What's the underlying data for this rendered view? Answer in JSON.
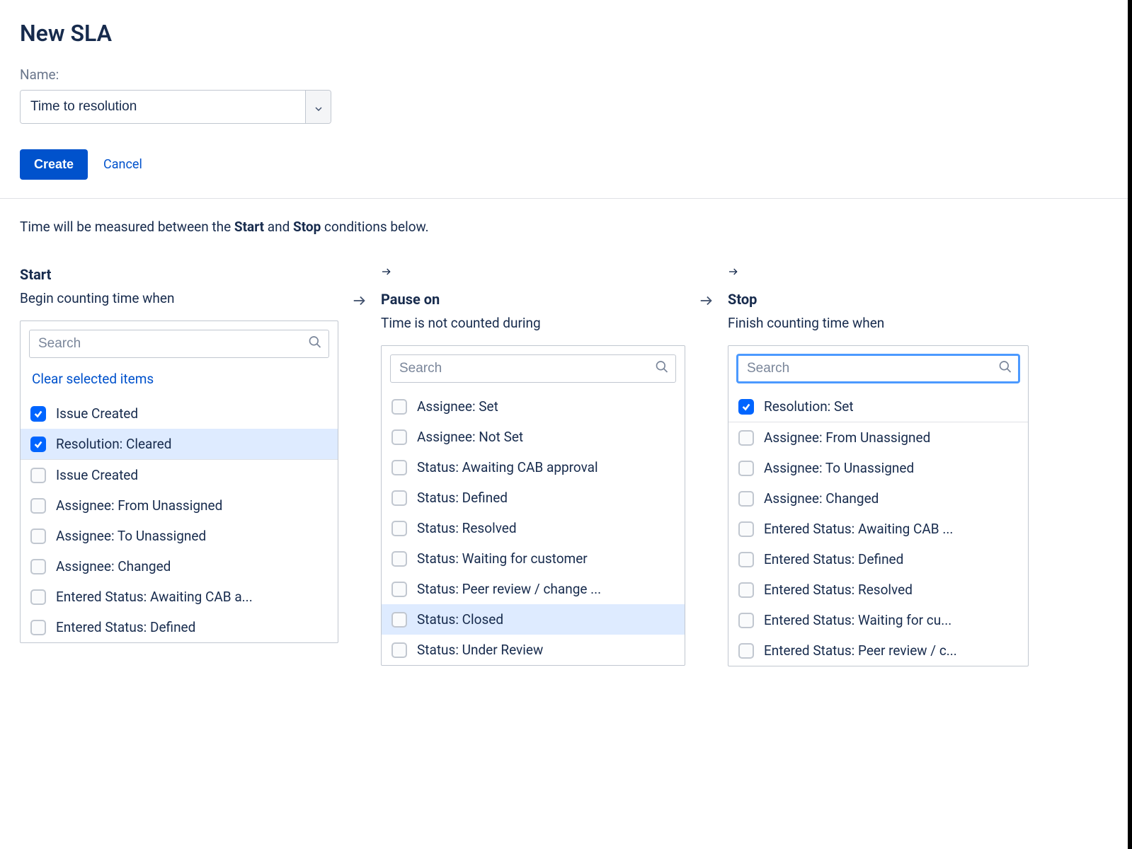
{
  "title": "New SLA",
  "name_label": "Name:",
  "name_value": "Time to resolution",
  "create_label": "Create",
  "cancel_label": "Cancel",
  "measure_prefix": "Time will be measured between the ",
  "measure_mid": " and ",
  "measure_suffix": " conditions below.",
  "start_word": "Start",
  "stop_word": "Stop",
  "search_placeholder": "Search",
  "clear_label": "Clear selected items",
  "columns": {
    "start": {
      "title": "Start",
      "subtitle": "Begin counting time when",
      "search_focused": false,
      "show_clear": true,
      "selected": [
        {
          "label": "Issue Created",
          "checked": true,
          "highlight": false
        },
        {
          "label": "Resolution: Cleared",
          "checked": true,
          "highlight": true
        }
      ],
      "items": [
        {
          "label": "Issue Created",
          "checked": false
        },
        {
          "label": "Assignee: From Unassigned",
          "checked": false
        },
        {
          "label": "Assignee: To Unassigned",
          "checked": false
        },
        {
          "label": "Assignee: Changed",
          "checked": false
        },
        {
          "label": "Entered Status: Awaiting CAB a...",
          "checked": false
        },
        {
          "label": "Entered Status: Defined",
          "checked": false
        }
      ]
    },
    "pause": {
      "title": "Pause on",
      "subtitle": "Time is not counted during",
      "search_focused": false,
      "items": [
        {
          "label": "Assignee: Set",
          "checked": false
        },
        {
          "label": "Assignee: Not Set",
          "checked": false
        },
        {
          "label": "Status: Awaiting CAB approval",
          "checked": false
        },
        {
          "label": "Status: Defined",
          "checked": false
        },
        {
          "label": "Status: Resolved",
          "checked": false
        },
        {
          "label": "Status: Waiting for customer",
          "checked": false
        },
        {
          "label": "Status: Peer review / change ...",
          "checked": false
        },
        {
          "label": "Status: Closed",
          "checked": false,
          "highlight": true
        },
        {
          "label": "Status: Under Review",
          "checked": false
        }
      ]
    },
    "stop": {
      "title": "Stop",
      "subtitle": "Finish counting time when",
      "search_focused": true,
      "selected": [
        {
          "label": "Resolution: Set",
          "checked": true
        }
      ],
      "items": [
        {
          "label": "Assignee: From Unassigned",
          "checked": false
        },
        {
          "label": "Assignee: To Unassigned",
          "checked": false
        },
        {
          "label": "Assignee: Changed",
          "checked": false
        },
        {
          "label": "Entered Status: Awaiting CAB ...",
          "checked": false
        },
        {
          "label": "Entered Status: Defined",
          "checked": false
        },
        {
          "label": "Entered Status: Resolved",
          "checked": false
        },
        {
          "label": "Entered Status: Waiting for cu...",
          "checked": false
        },
        {
          "label": "Entered Status: Peer review / c...",
          "checked": false
        }
      ]
    }
  }
}
